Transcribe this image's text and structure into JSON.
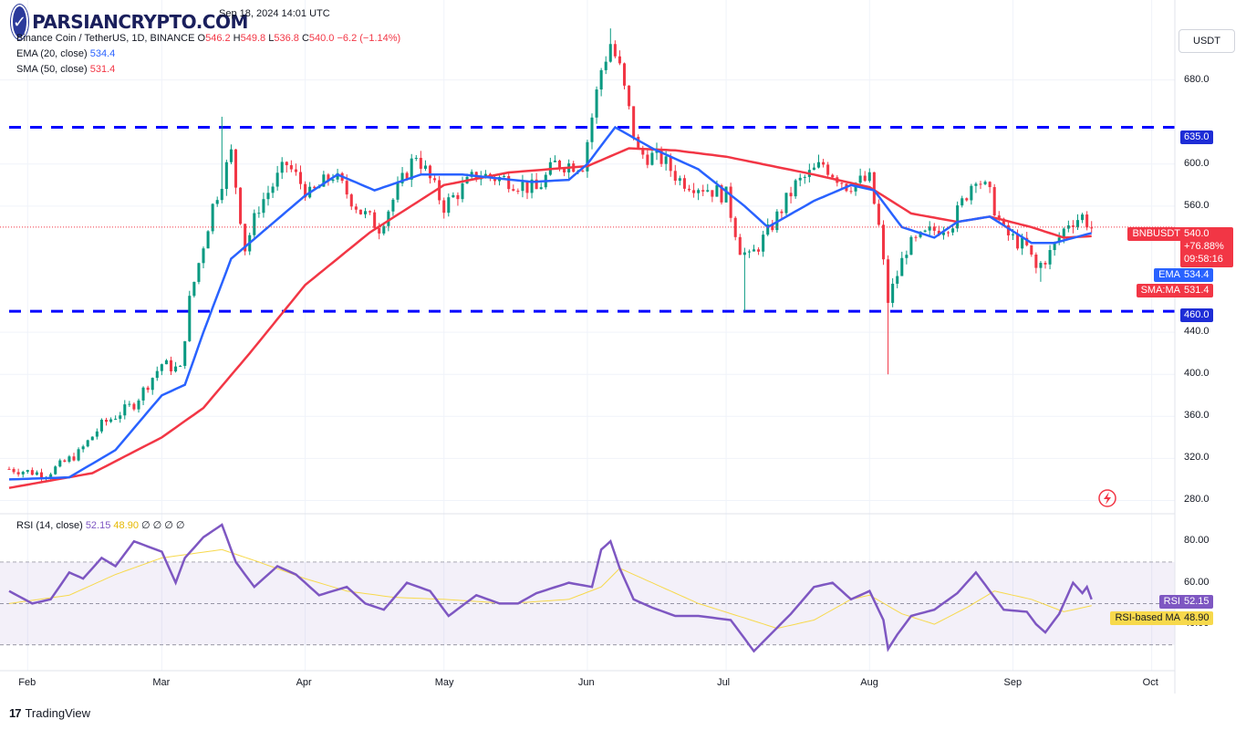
{
  "header": {
    "timestamp": "Sep 18, 2024 14:01 UTC",
    "symbol": "Binance Coin / TetherUS, 1D, BINANCE",
    "ohlc": {
      "o_label": "O",
      "o": "546.2",
      "h_label": "H",
      "h": "549.8",
      "l_label": "L",
      "l": "536.8",
      "c_label": "C",
      "c": "540.0",
      "change": "−6.2 (−1.14%)"
    },
    "ema_label": "EMA (20, close)",
    "ema_value": "534.4",
    "sma_label": "SMA (50, close)",
    "sma_value": "531.4",
    "rsi_label": "RSI (14, close)",
    "rsi_value": "52.15",
    "rsi_ma_value": "48.90",
    "rsi_extra": "∅ ∅ ∅ ∅"
  },
  "watermark": {
    "text": "PARSIANCRYPTO.COM",
    "mark": "✓"
  },
  "currency_button": "USDT",
  "tags": {
    "symbol": "BNBUSDT",
    "price": "540.0",
    "pct": "+76.88%",
    "countdown": "09:58:16",
    "ema_tag": "EMA",
    "ema_val": "534.4",
    "sma_tag": "SMA:MA",
    "sma_val": "531.4",
    "level_high": "635.0",
    "level_low": "460.0",
    "rsi_tag": "RSI",
    "rsi_val": "52.15",
    "rsi_ma_tag": "RSI-based MA",
    "rsi_ma_val": "48.90"
  },
  "footer": {
    "brand": "TradingView",
    "icon": "17"
  },
  "colors": {
    "up": "#089981",
    "down": "#f23645",
    "ema": "#2962ff",
    "sma": "#f23645",
    "level": "#0000ff",
    "rsi": "#7e57c2",
    "rsi_ma": "#f7d94c"
  },
  "chart_data": {
    "type": "candlestick",
    "symbol": "BNBUSDT",
    "timeframe": "1D",
    "price_axis": {
      "ticks": [
        "680.0",
        "600.0",
        "560.0",
        "440.0",
        "400.0",
        "360.0",
        "320.0",
        "280.0"
      ],
      "range": [
        270,
        730
      ]
    },
    "rsi_axis": {
      "ticks": [
        "80.00",
        "60.00",
        "40.00"
      ],
      "range": [
        18,
        92
      ],
      "bands": [
        70,
        30
      ],
      "mid": 50
    },
    "time_axis": {
      "labels": [
        "Feb",
        "Mar",
        "Apr",
        "May",
        "Jun",
        "Jul",
        "Aug",
        "Sep",
        "Oct"
      ],
      "label_dates": [
        "2024-02-01",
        "2024-03-01",
        "2024-04-01",
        "2024-05-01",
        "2024-06-01",
        "2024-07-01",
        "2024-08-01",
        "2024-09-01",
        "2024-10-01"
      ]
    },
    "horizontal_levels": [
      635,
      460
    ],
    "price_keyframes": [
      [
        "2024-01-28",
        310
      ],
      [
        "2024-02-05",
        305
      ],
      [
        "2024-02-12",
        325
      ],
      [
        "2024-02-17",
        352
      ],
      [
        "2024-02-24",
        372
      ],
      [
        "2024-03-01",
        410
      ],
      [
        "2024-03-05",
        404
      ],
      [
        "2024-03-07",
        470
      ],
      [
        "2024-03-12",
        560
      ],
      [
        "2024-03-16",
        610
      ],
      [
        "2024-03-19",
        520
      ],
      [
        "2024-03-22",
        560
      ],
      [
        "2024-03-28",
        600
      ],
      [
        "2024-04-02",
        570
      ],
      [
        "2024-04-07",
        590
      ],
      [
        "2024-04-13",
        555
      ],
      [
        "2024-04-17",
        540
      ],
      [
        "2024-04-21",
        575
      ],
      [
        "2024-04-25",
        610
      ],
      [
        "2024-05-01",
        560
      ],
      [
        "2024-05-08",
        590
      ],
      [
        "2024-05-15",
        585
      ],
      [
        "2024-05-21",
        575
      ],
      [
        "2024-05-25",
        600
      ],
      [
        "2024-05-31",
        600
      ],
      [
        "2024-06-04",
        690
      ],
      [
        "2024-06-06",
        715
      ],
      [
        "2024-06-08",
        690
      ],
      [
        "2024-06-12",
        610
      ],
      [
        "2024-06-17",
        605
      ],
      [
        "2024-06-21",
        585
      ],
      [
        "2024-06-27",
        577
      ],
      [
        "2024-07-01",
        570
      ],
      [
        "2024-07-04",
        520
      ],
      [
        "2024-07-06",
        510
      ],
      [
        "2024-07-10",
        535
      ],
      [
        "2024-07-16",
        580
      ],
      [
        "2024-07-22",
        600
      ],
      [
        "2024-07-27",
        580
      ],
      [
        "2024-08-01",
        585
      ],
      [
        "2024-08-03",
        540
      ],
      [
        "2024-08-05",
        470
      ],
      [
        "2024-08-09",
        520
      ],
      [
        "2024-08-14",
        535
      ],
      [
        "2024-08-19",
        545
      ],
      [
        "2024-08-24",
        590
      ],
      [
        "2024-08-27",
        570
      ],
      [
        "2024-08-30",
        535
      ],
      [
        "2024-09-04",
        520
      ],
      [
        "2024-09-06",
        500
      ],
      [
        "2024-09-09",
        515
      ],
      [
        "2024-09-13",
        545
      ],
      [
        "2024-09-16",
        550
      ],
      [
        "2024-09-18",
        540
      ]
    ],
    "price_extremes": [
      [
        "2024-03-14",
        645,
        "high"
      ],
      [
        "2024-06-06",
        729,
        "high"
      ],
      [
        "2024-07-05",
        460,
        "low"
      ],
      [
        "2024-08-05",
        400,
        "low"
      ],
      [
        "2024-09-07",
        488,
        "low"
      ]
    ],
    "ema_keyframes": [
      [
        "2024-01-28",
        300
      ],
      [
        "2024-02-10",
        302
      ],
      [
        "2024-02-20",
        328
      ],
      [
        "2024-03-01",
        380
      ],
      [
        "2024-03-06",
        390
      ],
      [
        "2024-03-10",
        440
      ],
      [
        "2024-03-16",
        510
      ],
      [
        "2024-03-24",
        540
      ],
      [
        "2024-04-01",
        570
      ],
      [
        "2024-04-08",
        590
      ],
      [
        "2024-04-16",
        575
      ],
      [
        "2024-04-26",
        590
      ],
      [
        "2024-05-05",
        590
      ],
      [
        "2024-05-20",
        583
      ],
      [
        "2024-05-28",
        585
      ],
      [
        "2024-06-01",
        600
      ],
      [
        "2024-06-07",
        635
      ],
      [
        "2024-06-15",
        615
      ],
      [
        "2024-06-25",
        595
      ],
      [
        "2024-07-05",
        560
      ],
      [
        "2024-07-10",
        540
      ],
      [
        "2024-07-20",
        565
      ],
      [
        "2024-07-28",
        580
      ],
      [
        "2024-08-02",
        575
      ],
      [
        "2024-08-08",
        540
      ],
      [
        "2024-08-15",
        530
      ],
      [
        "2024-08-20",
        545
      ],
      [
        "2024-08-27",
        550
      ],
      [
        "2024-09-05",
        525
      ],
      [
        "2024-09-10",
        525
      ],
      [
        "2024-09-18",
        534.4
      ]
    ],
    "sma_keyframes": [
      [
        "2024-01-28",
        292
      ],
      [
        "2024-02-15",
        306
      ],
      [
        "2024-03-01",
        340
      ],
      [
        "2024-03-10",
        368
      ],
      [
        "2024-03-20",
        420
      ],
      [
        "2024-04-01",
        485
      ],
      [
        "2024-04-15",
        535
      ],
      [
        "2024-05-01",
        580
      ],
      [
        "2024-05-15",
        592
      ],
      [
        "2024-06-01",
        598
      ],
      [
        "2024-06-10",
        615
      ],
      [
        "2024-06-20",
        613
      ],
      [
        "2024-07-01",
        607
      ],
      [
        "2024-07-20",
        590
      ],
      [
        "2024-08-01",
        578
      ],
      [
        "2024-08-10",
        553
      ],
      [
        "2024-08-20",
        545
      ],
      [
        "2024-08-27",
        550
      ],
      [
        "2024-09-05",
        540
      ],
      [
        "2024-09-12",
        530
      ],
      [
        "2024-09-18",
        531.4
      ]
    ],
    "rsi_keyframes": [
      [
        "2024-01-28",
        56
      ],
      [
        "2024-02-02",
        50
      ],
      [
        "2024-02-06",
        52
      ],
      [
        "2024-02-10",
        65
      ],
      [
        "2024-02-13",
        62
      ],
      [
        "2024-02-17",
        72
      ],
      [
        "2024-02-20",
        68
      ],
      [
        "2024-02-24",
        80
      ],
      [
        "2024-03-01",
        75
      ],
      [
        "2024-03-04",
        60
      ],
      [
        "2024-03-06",
        72
      ],
      [
        "2024-03-10",
        82
      ],
      [
        "2024-03-14",
        88
      ],
      [
        "2024-03-17",
        70
      ],
      [
        "2024-03-21",
        58
      ],
      [
        "2024-03-26",
        68
      ],
      [
        "2024-03-30",
        64
      ],
      [
        "2024-04-04",
        54
      ],
      [
        "2024-04-10",
        58
      ],
      [
        "2024-04-14",
        50
      ],
      [
        "2024-04-18",
        47
      ],
      [
        "2024-04-23",
        60
      ],
      [
        "2024-04-28",
        56
      ],
      [
        "2024-05-02",
        44
      ],
      [
        "2024-05-08",
        54
      ],
      [
        "2024-05-13",
        50
      ],
      [
        "2024-05-17",
        50
      ],
      [
        "2024-05-21",
        55
      ],
      [
        "2024-05-28",
        60
      ],
      [
        "2024-06-02",
        58
      ],
      [
        "2024-06-04",
        76
      ],
      [
        "2024-06-06",
        80
      ],
      [
        "2024-06-08",
        67
      ],
      [
        "2024-06-11",
        52
      ],
      [
        "2024-06-15",
        48
      ],
      [
        "2024-06-20",
        44
      ],
      [
        "2024-06-25",
        44
      ],
      [
        "2024-07-02",
        42
      ],
      [
        "2024-07-05",
        33
      ],
      [
        "2024-07-07",
        27
      ],
      [
        "2024-07-11",
        36
      ],
      [
        "2024-07-15",
        45
      ],
      [
        "2024-07-20",
        58
      ],
      [
        "2024-07-24",
        60
      ],
      [
        "2024-07-28",
        52
      ],
      [
        "2024-08-01",
        56
      ],
      [
        "2024-08-04",
        42
      ],
      [
        "2024-08-05",
        28
      ],
      [
        "2024-08-07",
        35
      ],
      [
        "2024-08-10",
        44
      ],
      [
        "2024-08-15",
        47
      ],
      [
        "2024-08-20",
        55
      ],
      [
        "2024-08-24",
        65
      ],
      [
        "2024-08-27",
        56
      ],
      [
        "2024-08-30",
        47
      ],
      [
        "2024-09-04",
        46
      ],
      [
        "2024-09-06",
        40
      ],
      [
        "2024-09-08",
        36
      ],
      [
        "2024-09-11",
        45
      ],
      [
        "2024-09-14",
        60
      ],
      [
        "2024-09-16",
        55
      ],
      [
        "2024-09-17",
        58
      ],
      [
        "2024-09-18",
        52
      ]
    ],
    "rsi_ma_keyframes": [
      [
        "2024-01-28",
        50
      ],
      [
        "2024-02-10",
        54
      ],
      [
        "2024-02-20",
        64
      ],
      [
        "2024-03-01",
        72
      ],
      [
        "2024-03-14",
        76
      ],
      [
        "2024-03-22",
        70
      ],
      [
        "2024-04-01",
        62
      ],
      [
        "2024-04-10",
        56
      ],
      [
        "2024-04-20",
        53
      ],
      [
        "2024-05-01",
        52
      ],
      [
        "2024-05-15",
        50
      ],
      [
        "2024-05-28",
        52
      ],
      [
        "2024-06-04",
        58
      ],
      [
        "2024-06-08",
        67
      ],
      [
        "2024-06-15",
        60
      ],
      [
        "2024-06-25",
        50
      ],
      [
        "2024-07-05",
        43
      ],
      [
        "2024-07-12",
        38
      ],
      [
        "2024-07-20",
        42
      ],
      [
        "2024-07-28",
        52
      ],
      [
        "2024-08-01",
        54
      ],
      [
        "2024-08-08",
        45
      ],
      [
        "2024-08-15",
        40
      ],
      [
        "2024-08-22",
        48
      ],
      [
        "2024-08-28",
        56
      ],
      [
        "2024-09-05",
        52
      ],
      [
        "2024-09-12",
        46
      ],
      [
        "2024-09-18",
        48.9
      ]
    ]
  }
}
